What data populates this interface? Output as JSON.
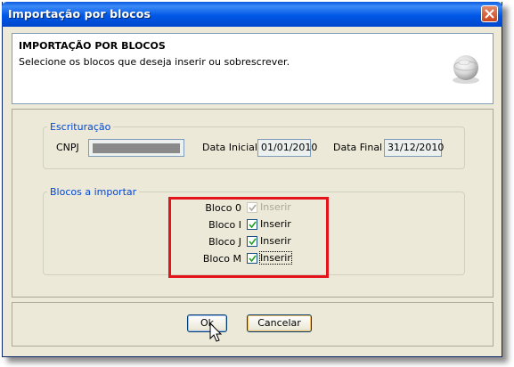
{
  "window": {
    "title": "Importação por blocos"
  },
  "header": {
    "title": "IMPORTAÇÃO POR BLOCOS",
    "subtitle": "Selecione os blocos que deseja inserir ou sobrescrever."
  },
  "escrituracao": {
    "legend": "Escrituração",
    "cnpj_label": "CNPJ",
    "cnpj_value": "",
    "data_inicial_label": "Data Inicial",
    "data_inicial_value": "01/01/2010",
    "data_final_label": "Data Final",
    "data_final_value": "31/12/2010"
  },
  "blocos": {
    "legend": "Blocos a importar",
    "items": [
      {
        "label": "Bloco 0",
        "text": "Inserir",
        "checked": true,
        "enabled": false
      },
      {
        "label": "Bloco I",
        "text": "Inserir",
        "checked": true,
        "enabled": true
      },
      {
        "label": "Bloco J",
        "text": "Inserir",
        "checked": true,
        "enabled": true
      },
      {
        "label": "Bloco M",
        "text": "Inserir",
        "checked": true,
        "enabled": true
      }
    ]
  },
  "buttons": {
    "ok": "Ok",
    "cancel": "Cancelar"
  },
  "colors": {
    "title_bar": "#0058e6",
    "legend": "#0046d5",
    "highlight": "#e5141c"
  }
}
